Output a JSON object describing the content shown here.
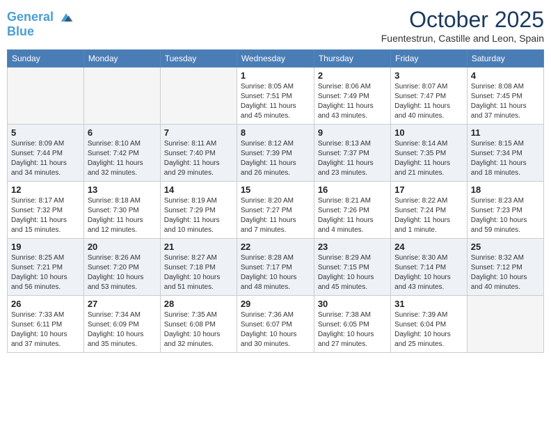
{
  "header": {
    "logo_line1": "General",
    "logo_line2": "Blue",
    "month": "October 2025",
    "location": "Fuentestrun, Castille and Leon, Spain"
  },
  "weekdays": [
    "Sunday",
    "Monday",
    "Tuesday",
    "Wednesday",
    "Thursday",
    "Friday",
    "Saturday"
  ],
  "weeks": [
    [
      {
        "day": "",
        "info": ""
      },
      {
        "day": "",
        "info": ""
      },
      {
        "day": "",
        "info": ""
      },
      {
        "day": "1",
        "info": "Sunrise: 8:05 AM\nSunset: 7:51 PM\nDaylight: 11 hours\nand 45 minutes."
      },
      {
        "day": "2",
        "info": "Sunrise: 8:06 AM\nSunset: 7:49 PM\nDaylight: 11 hours\nand 43 minutes."
      },
      {
        "day": "3",
        "info": "Sunrise: 8:07 AM\nSunset: 7:47 PM\nDaylight: 11 hours\nand 40 minutes."
      },
      {
        "day": "4",
        "info": "Sunrise: 8:08 AM\nSunset: 7:45 PM\nDaylight: 11 hours\nand 37 minutes."
      }
    ],
    [
      {
        "day": "5",
        "info": "Sunrise: 8:09 AM\nSunset: 7:44 PM\nDaylight: 11 hours\nand 34 minutes."
      },
      {
        "day": "6",
        "info": "Sunrise: 8:10 AM\nSunset: 7:42 PM\nDaylight: 11 hours\nand 32 minutes."
      },
      {
        "day": "7",
        "info": "Sunrise: 8:11 AM\nSunset: 7:40 PM\nDaylight: 11 hours\nand 29 minutes."
      },
      {
        "day": "8",
        "info": "Sunrise: 8:12 AM\nSunset: 7:39 PM\nDaylight: 11 hours\nand 26 minutes."
      },
      {
        "day": "9",
        "info": "Sunrise: 8:13 AM\nSunset: 7:37 PM\nDaylight: 11 hours\nand 23 minutes."
      },
      {
        "day": "10",
        "info": "Sunrise: 8:14 AM\nSunset: 7:35 PM\nDaylight: 11 hours\nand 21 minutes."
      },
      {
        "day": "11",
        "info": "Sunrise: 8:15 AM\nSunset: 7:34 PM\nDaylight: 11 hours\nand 18 minutes."
      }
    ],
    [
      {
        "day": "12",
        "info": "Sunrise: 8:17 AM\nSunset: 7:32 PM\nDaylight: 11 hours\nand 15 minutes."
      },
      {
        "day": "13",
        "info": "Sunrise: 8:18 AM\nSunset: 7:30 PM\nDaylight: 11 hours\nand 12 minutes."
      },
      {
        "day": "14",
        "info": "Sunrise: 8:19 AM\nSunset: 7:29 PM\nDaylight: 11 hours\nand 10 minutes."
      },
      {
        "day": "15",
        "info": "Sunrise: 8:20 AM\nSunset: 7:27 PM\nDaylight: 11 hours\nand 7 minutes."
      },
      {
        "day": "16",
        "info": "Sunrise: 8:21 AM\nSunset: 7:26 PM\nDaylight: 11 hours\nand 4 minutes."
      },
      {
        "day": "17",
        "info": "Sunrise: 8:22 AM\nSunset: 7:24 PM\nDaylight: 11 hours\nand 1 minute."
      },
      {
        "day": "18",
        "info": "Sunrise: 8:23 AM\nSunset: 7:23 PM\nDaylight: 10 hours\nand 59 minutes."
      }
    ],
    [
      {
        "day": "19",
        "info": "Sunrise: 8:25 AM\nSunset: 7:21 PM\nDaylight: 10 hours\nand 56 minutes."
      },
      {
        "day": "20",
        "info": "Sunrise: 8:26 AM\nSunset: 7:20 PM\nDaylight: 10 hours\nand 53 minutes."
      },
      {
        "day": "21",
        "info": "Sunrise: 8:27 AM\nSunset: 7:18 PM\nDaylight: 10 hours\nand 51 minutes."
      },
      {
        "day": "22",
        "info": "Sunrise: 8:28 AM\nSunset: 7:17 PM\nDaylight: 10 hours\nand 48 minutes."
      },
      {
        "day": "23",
        "info": "Sunrise: 8:29 AM\nSunset: 7:15 PM\nDaylight: 10 hours\nand 45 minutes."
      },
      {
        "day": "24",
        "info": "Sunrise: 8:30 AM\nSunset: 7:14 PM\nDaylight: 10 hours\nand 43 minutes."
      },
      {
        "day": "25",
        "info": "Sunrise: 8:32 AM\nSunset: 7:12 PM\nDaylight: 10 hours\nand 40 minutes."
      }
    ],
    [
      {
        "day": "26",
        "info": "Sunrise: 7:33 AM\nSunset: 6:11 PM\nDaylight: 10 hours\nand 37 minutes."
      },
      {
        "day": "27",
        "info": "Sunrise: 7:34 AM\nSunset: 6:09 PM\nDaylight: 10 hours\nand 35 minutes."
      },
      {
        "day": "28",
        "info": "Sunrise: 7:35 AM\nSunset: 6:08 PM\nDaylight: 10 hours\nand 32 minutes."
      },
      {
        "day": "29",
        "info": "Sunrise: 7:36 AM\nSunset: 6:07 PM\nDaylight: 10 hours\nand 30 minutes."
      },
      {
        "day": "30",
        "info": "Sunrise: 7:38 AM\nSunset: 6:05 PM\nDaylight: 10 hours\nand 27 minutes."
      },
      {
        "day": "31",
        "info": "Sunrise: 7:39 AM\nSunset: 6:04 PM\nDaylight: 10 hours\nand 25 minutes."
      },
      {
        "day": "",
        "info": ""
      }
    ]
  ]
}
